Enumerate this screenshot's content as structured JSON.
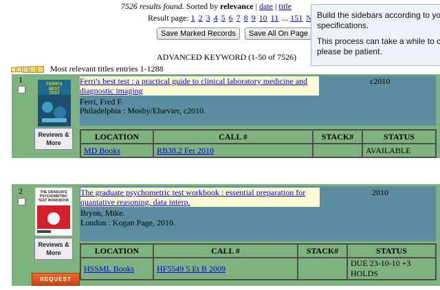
{
  "summary": {
    "results_text": "7526 results found.",
    "sorted_prefix": "Sorted by",
    "sort_current": "relevance",
    "sort_options": [
      "date",
      "title"
    ],
    "sep": "|",
    "result_page_label": "Result page:",
    "pages": [
      "1",
      "2",
      "3",
      "4",
      "5",
      "6",
      "7",
      "8",
      "9",
      "10",
      "11"
    ],
    "ellipsis": "...",
    "last_page": "151",
    "next_label": "Next",
    "save_marked": "Save Marked Records",
    "save_all": "Save All On Page",
    "heading": "ADVANCED KEYWORD (1-50 of 7526)",
    "relevance_text": "Most relevant titles entries 1-1288"
  },
  "tooltip": {
    "line1": "Build the sidebars according to your",
    "line1b": "specifications.",
    "line2": "This process can take a while to com",
    "line2b": "please be patient."
  },
  "records": [
    {
      "num": "1",
      "cover_text": "FERRI'S BEST TEST",
      "reviews": "Reviews & More",
      "title": "Ferri's best test : a practical guide to clinical laboratory medicine and diagnostic imaging",
      "author": "Ferri, Fred F.",
      "publisher": "Philadelphia : Mosby/Elsevier, c2010.",
      "year": "c2010",
      "holdings_headers": [
        "LOCATION",
        "CALL #",
        "STACK#",
        "STATUS"
      ],
      "holdings": [
        {
          "location": "MD Books",
          "call": "RB38.2 Fer 2010",
          "stack": "",
          "status": "AVAILABLE"
        }
      ]
    },
    {
      "num": "2",
      "cover_text": "THE GRADUATE PSYCHOMETRIC TEST WORKBOOK",
      "reviews": "Reviews & More",
      "title": "The graduate psychometric test workbook : essential preparation for quantative reasoning, data interp.",
      "author": "Bryon, Mike.",
      "publisher": "London : Kogan Page, 2010.",
      "year": "2010",
      "holdings_headers": [
        "LOCATION",
        "CALL #",
        "STACK#",
        "STATUS"
      ],
      "holdings": [
        {
          "location": "HSSML Books",
          "call": "HF5549 5 Et B 2009",
          "stack": "",
          "status": "DUE 23-10-10 +3 HOLDS"
        }
      ],
      "request_label": "REQUEST"
    }
  ],
  "colors": {
    "record_bg": "#7eb27e",
    "inner_bg": "#5a8ea0",
    "title_bg": "#fff9d2",
    "link": "#0000ee",
    "request": "#e05a1e"
  }
}
